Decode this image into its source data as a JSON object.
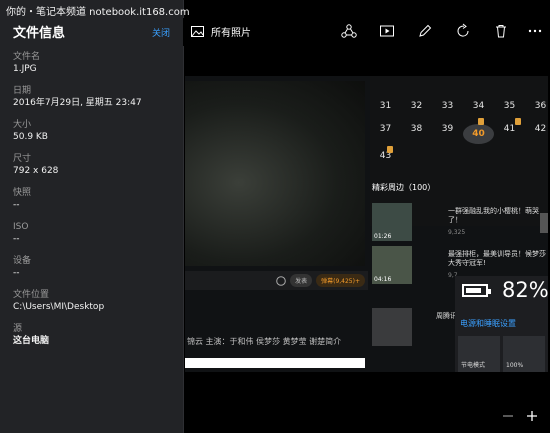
{
  "watermark": "你的・笔记本频道 notebook.it168.com",
  "panel": {
    "title": "文件信息",
    "close_label": "关闭",
    "fields": [
      {
        "label": "文件名",
        "value": "1.JPG"
      },
      {
        "label": "日期",
        "value": "2016年7月29日, 星期五 23:47"
      },
      {
        "label": "大小",
        "value": "50.9 KB"
      },
      {
        "label": "尺寸",
        "value": "792 x 628"
      },
      {
        "label": "快照",
        "value": "--"
      },
      {
        "label": "ISO",
        "value": "--"
      },
      {
        "label": "设备",
        "value": "--"
      },
      {
        "label": "文件位置",
        "value": "C:\\Users\\MI\\Desktop"
      },
      {
        "label": "源",
        "value": "这台电脑"
      }
    ]
  },
  "toolbar": {
    "album_label": "所有照片",
    "icons": [
      "share-icon",
      "slideshow-icon",
      "edit-icon",
      "rotate-icon",
      "delete-icon",
      "more-icon"
    ]
  },
  "photo": {
    "calendar_rows": [
      [
        "31",
        "32",
        "33",
        "34",
        "35",
        "36"
      ],
      [
        "37",
        "38",
        "39",
        "40",
        "41",
        "42"
      ],
      [
        "43"
      ]
    ],
    "today": "40",
    "section_title": "精彩周边（100）",
    "items": [
      {
        "desc": "一群强融乱我的小樱桃！萌哭了！",
        "duration": "01:26",
        "meta": "9,325"
      },
      {
        "desc": "最强排柜，最美训导员！候梦莎大秀守冠军!",
        "duration": "04:16",
        "meta": "9,7"
      },
      {
        "desc": "周腾讯 超强",
        "duration": "",
        "meta": ""
      }
    ],
    "comment_pills": [
      "发表",
      "弹幕(9,425)+"
    ],
    "cast_line": "锦云    主演：于和伟 侯梦莎 黄梦莹 谢楚简介",
    "battery": {
      "percent": "82%",
      "link": "电源和睡眠设置",
      "tiles": [
        "节电模式",
        "100%"
      ]
    }
  },
  "bottom": {
    "minus_icon": "zoom-out-icon",
    "plus_icon": "zoom-in-icon"
  }
}
